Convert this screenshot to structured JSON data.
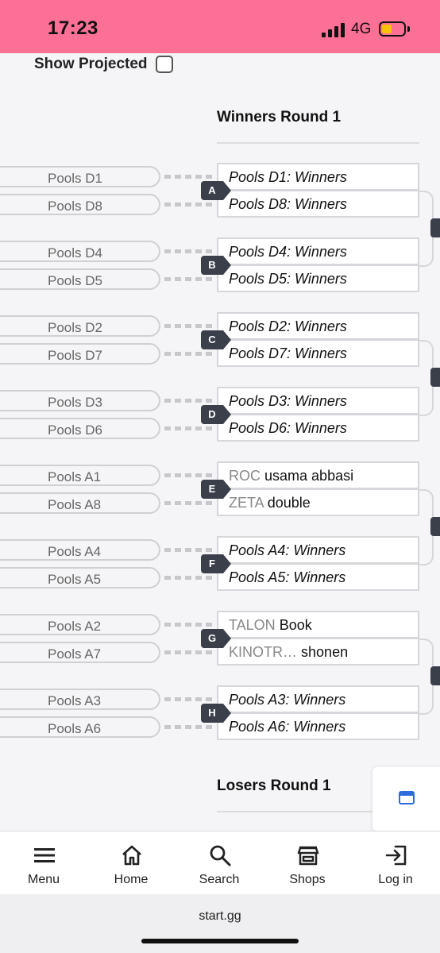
{
  "status_bar": {
    "time": "17:23",
    "network": "4G"
  },
  "page": {
    "show_projected_label": "Show Projected",
    "winners_round_title": "Winners Round 1",
    "losers_round_title": "Losers Round 1"
  },
  "entrants": [
    "Pools D1",
    "Pools D8",
    "Pools D4",
    "Pools D5",
    "Pools D2",
    "Pools D7",
    "Pools D3",
    "Pools D6",
    "Pools A1",
    "Pools A8",
    "Pools A4",
    "Pools A5",
    "Pools A2",
    "Pools A7",
    "Pools A3",
    "Pools A6"
  ],
  "matches": [
    {
      "id": "A",
      "top": {
        "sponsor": "",
        "name": "Pools D1: Winners",
        "projected": true
      },
      "bottom": {
        "sponsor": "",
        "name": "Pools D8: Winners",
        "projected": true
      }
    },
    {
      "id": "B",
      "top": {
        "sponsor": "",
        "name": "Pools D4: Winners",
        "projected": true
      },
      "bottom": {
        "sponsor": "",
        "name": "Pools D5: Winners",
        "projected": true
      }
    },
    {
      "id": "C",
      "top": {
        "sponsor": "",
        "name": "Pools D2: Winners",
        "projected": true
      },
      "bottom": {
        "sponsor": "",
        "name": "Pools D7: Winners",
        "projected": true
      }
    },
    {
      "id": "D",
      "top": {
        "sponsor": "",
        "name": "Pools D3: Winners",
        "projected": true
      },
      "bottom": {
        "sponsor": "",
        "name": "Pools D6: Winners",
        "projected": true
      }
    },
    {
      "id": "E",
      "top": {
        "sponsor": "ROC",
        "name": "usama abbasi",
        "projected": false
      },
      "bottom": {
        "sponsor": "ZETA",
        "name": "double",
        "projected": false
      }
    },
    {
      "id": "F",
      "top": {
        "sponsor": "",
        "name": "Pools A4: Winners",
        "projected": true
      },
      "bottom": {
        "sponsor": "",
        "name": "Pools A5: Winners",
        "projected": true
      }
    },
    {
      "id": "G",
      "top": {
        "sponsor": "TALON",
        "name": "Book",
        "projected": false
      },
      "bottom": {
        "sponsor": "KINOTR…",
        "name": "shonen",
        "projected": false
      }
    },
    {
      "id": "H",
      "top": {
        "sponsor": "",
        "name": "Pools A3: Winners",
        "projected": true
      },
      "bottom": {
        "sponsor": "",
        "name": "Pools A6: Winners",
        "projected": true
      }
    }
  ],
  "bottom_nav": [
    {
      "label": "Menu",
      "icon": "menu-icon"
    },
    {
      "label": "Home",
      "icon": "home-icon"
    },
    {
      "label": "Search",
      "icon": "search-icon"
    },
    {
      "label": "Shops",
      "icon": "shop-icon"
    },
    {
      "label": "Log in",
      "icon": "login-icon"
    }
  ],
  "browser": {
    "url": "start.gg"
  }
}
